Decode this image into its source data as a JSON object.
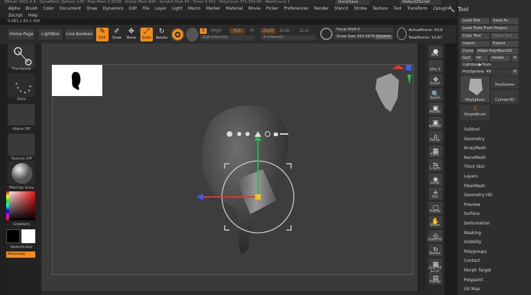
{
  "titlebar": {
    "text": "ZBrush 2021.6.6 · DynaMesh_Sphere_128 · Free Mem 3.32GB · Active Mem 630 · Scratch Disk 43 · Timer 0.001 · PolyCount 371.354 KP · MeshCount 1"
  },
  "menu": [
    "Alpha",
    "Brush",
    "Color",
    "Document",
    "Draw",
    "Dynamics",
    "Edit",
    "File",
    "Layer",
    "Light",
    "Macro",
    "Marker",
    "Material",
    "Movie",
    "Picker",
    "Preferences",
    "Render",
    "Stencil",
    "Stroke",
    "Texture",
    "Tool",
    "Transform",
    "Zplugin"
  ],
  "menu2": [
    "Zscript",
    "Help"
  ],
  "quicksave": "QuickSave",
  "script": "DefaultZScript",
  "coords": "0.083,1.83,1.065",
  "top": {
    "home": "Home Page",
    "lightbox": "LightBox",
    "live_boolean": "Live Boolean",
    "edit": "Edit",
    "draw": "Draw",
    "move": "Move",
    "scale": "Scale",
    "rotate": "Rotate",
    "a_label": "A",
    "mrgb": "Mrgb",
    "rgb": "Rgb",
    "m": "M",
    "zadd": "Zadd",
    "zsub": "Zsub",
    "zcut": "Zcut",
    "rgb_intensity": "Rgb Intensity",
    "z_intensity": "Z Intensity",
    "focal_shift_label": "Focal Shift",
    "focal_shift_value": "0",
    "draw_size_label": "Draw Size",
    "draw_size_value": "393.56762",
    "dynamic": "Dynamic",
    "active_points": "ActivePoints: 50,6",
    "total_points": "TotalPoints: 50,67"
  },
  "left": {
    "transpose": "Transpose",
    "dots": "Dots",
    "alpha_off": "Alpha Off",
    "texture_off": "Texture Off",
    "matcap": "MatCap Gray",
    "gradient": "Gradient",
    "switch_color": "SwitchColor",
    "alternate": "Alternate"
  },
  "right_shelf": [
    {
      "label": "BPR",
      "icon": "●"
    },
    {
      "label": "SPix 3",
      "icon": ""
    },
    {
      "label": "Scroll",
      "icon": "✥"
    },
    {
      "label": "Zoom",
      "icon": "🔍"
    },
    {
      "label": "Actual",
      "icon": "▣"
    },
    {
      "label": "AAHalf",
      "icon": "▣"
    },
    {
      "label": "Persp",
      "icon": "⌂"
    },
    {
      "label": "Floor",
      "icon": "▦"
    },
    {
      "label": "L.Sym",
      "icon": "⇆"
    },
    {
      "label": "Local",
      "icon": "◉"
    },
    {
      "label": "Xyz",
      "icon": "✛"
    },
    {
      "label": "Frame",
      "icon": "▢"
    },
    {
      "label": "Move",
      "icon": "✋"
    },
    {
      "label": "Zoom3D",
      "icon": "◎"
    },
    {
      "label": "Rotate",
      "icon": "↻"
    },
    {
      "label": "Line Fill PolyF",
      "icon": "▦"
    },
    {
      "label": "Transp",
      "icon": "▤"
    }
  ],
  "palette": {
    "title": "Tool",
    "load_tool": "Load Tool",
    "save_as": "Save As",
    "load_tools_from_project": "Load Tools From Project",
    "copy_tool": "Copy Tool",
    "paste_tool": "Paste Tool",
    "import": "Import",
    "export": "Export",
    "clone": "Clone",
    "make_polymesh": "Make PolyMesh3D",
    "goz": "GoZ",
    "all": "All",
    "visible": "Visible",
    "r": "R",
    "lightbox_tools": "Lightbox▶Tools",
    "current_tool_label": "PolySphere.",
    "current_tool_value": "48",
    "thumbs": [
      "PolySphere",
      "PolySphere",
      "Cylinder3D",
      "SimpleBrush"
    ],
    "subpalettes": [
      "Subtool",
      "Geometry",
      "ArrayMesh",
      "NanoMesh",
      "Thick Skin",
      "Layers",
      "FiberMesh",
      "Geometry HD",
      "Preview",
      "Surface",
      "Deformation",
      "Masking",
      "Visibility",
      "Polygroups",
      "Contact",
      "Morph Target",
      "Polypaint",
      "UV Map"
    ]
  },
  "colors": {
    "accent": "#f28c1a",
    "gizmo_red": "#e23a2a",
    "gizmo_green": "#2fb64a",
    "gizmo_blue": "#3a5ee8"
  }
}
